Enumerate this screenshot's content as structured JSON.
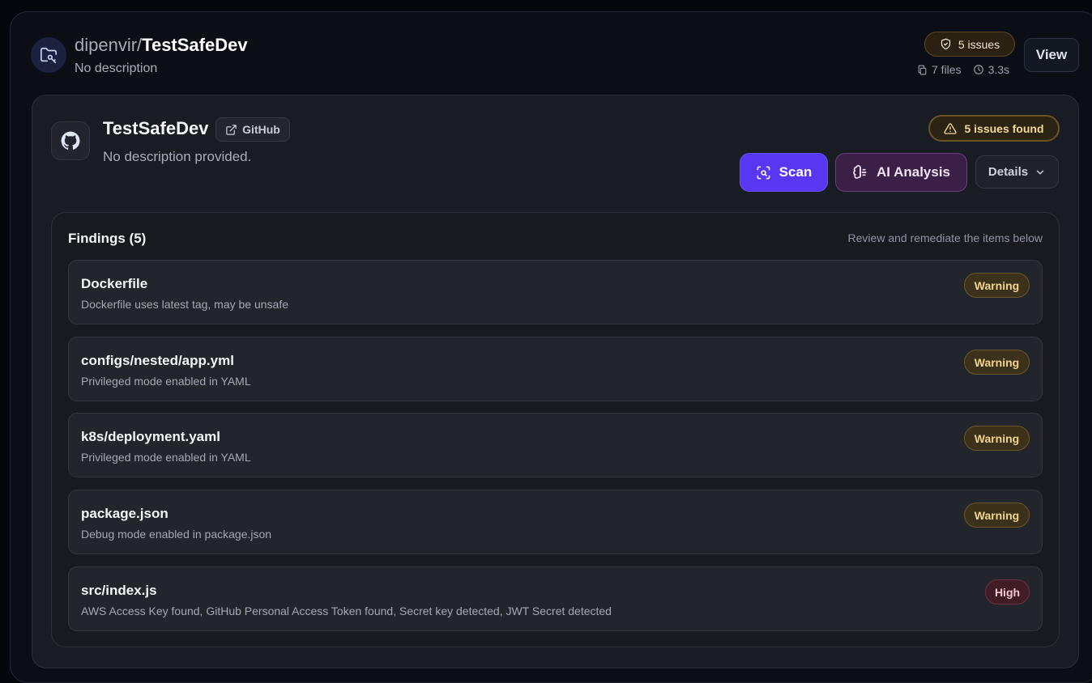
{
  "repo": {
    "owner": "dipenvir/",
    "name": "TestSafeDev",
    "description": "No description",
    "issues_label": "5 issues",
    "files_label": "7 files",
    "time_label": "3.3s",
    "view_label": "View"
  },
  "project": {
    "name": "TestSafeDev",
    "github_label": "GitHub",
    "description": "No description provided.",
    "issues_found_label": "5 issues found",
    "scan_label": "Scan",
    "ai_label": "AI Analysis",
    "details_label": "Details"
  },
  "findings": {
    "title": "Findings (5)",
    "hint": "Review and remediate the items below",
    "items": [
      {
        "file": "Dockerfile",
        "desc": "Dockerfile uses latest tag, may be unsafe",
        "severity": "Warning"
      },
      {
        "file": "configs/nested/app.yml",
        "desc": "Privileged mode enabled in YAML",
        "severity": "Warning"
      },
      {
        "file": "k8s/deployment.yaml",
        "desc": "Privileged mode enabled in YAML",
        "severity": "Warning"
      },
      {
        "file": "package.json",
        "desc": "Debug mode enabled in package.json",
        "severity": "Warning"
      },
      {
        "file": "src/index.js",
        "desc": "AWS Access Key found, GitHub Personal Access Token found, Secret key detected, JWT Secret detected",
        "severity": "High"
      }
    ]
  },
  "icons": {
    "repo": "folder-key-icon",
    "issues": "shield-check-icon",
    "files": "files-icon",
    "time": "clock-icon",
    "github": "github-icon",
    "external": "external-link-icon",
    "warning": "alert-triangle-icon",
    "scan": "scan-icon",
    "ai": "brain-icon",
    "details": "chevron-down-icon"
  },
  "colors": {
    "accent": "#5737f2",
    "warning": "#f1d48c",
    "high": "#f3c6d0"
  }
}
